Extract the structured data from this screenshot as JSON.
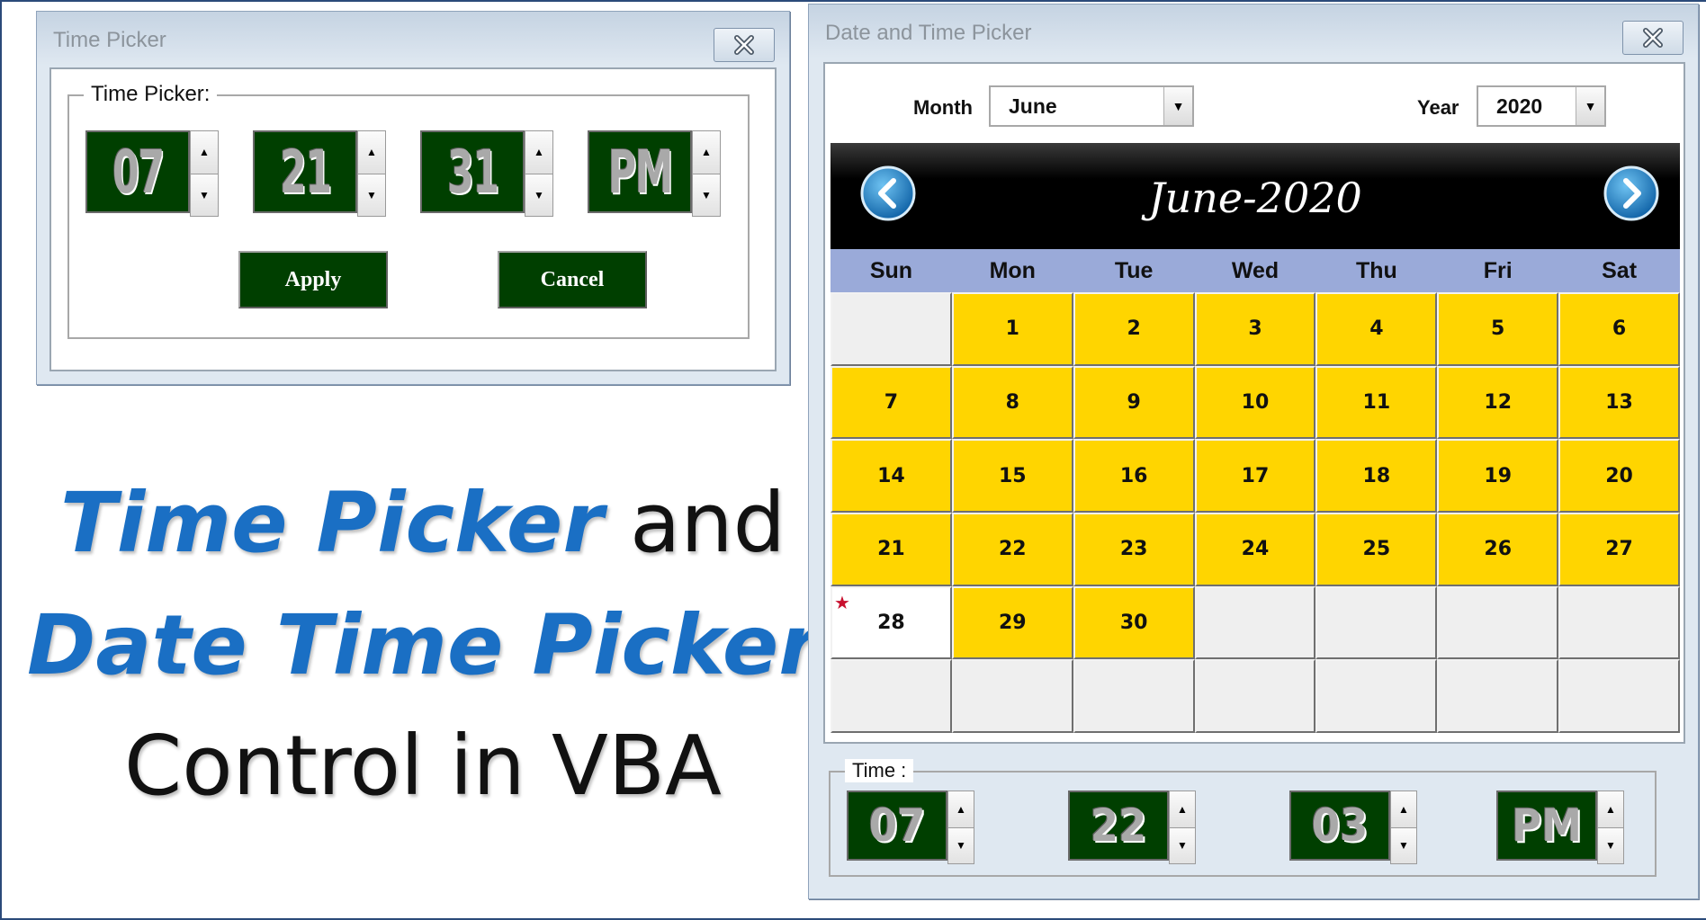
{
  "time_picker": {
    "window_title": "Time Picker",
    "group_label": "Time Picker:",
    "hour": "07",
    "minute": "21",
    "second": "31",
    "ampm": "PM",
    "apply_label": "Apply",
    "cancel_label": "Cancel"
  },
  "headline": {
    "line1_emphasis": "Time Picker",
    "line1_rest": " and",
    "line2_emphasis": "Date Time Picker",
    "line3": "Control in VBA"
  },
  "date_time_picker": {
    "window_title": "Date and Time Picker",
    "month_label": "Month",
    "month_value": "June",
    "year_label": "Year",
    "year_value": "2020",
    "calendar_title": "June-2020",
    "weekdays": [
      "Sun",
      "Mon",
      "Tue",
      "Wed",
      "Thu",
      "Fri",
      "Sat"
    ],
    "weeks": [
      [
        "",
        "1",
        "2",
        "3",
        "4",
        "5",
        "6"
      ],
      [
        "7",
        "8",
        "9",
        "10",
        "11",
        "12",
        "13"
      ],
      [
        "14",
        "15",
        "16",
        "17",
        "18",
        "19",
        "20"
      ],
      [
        "21",
        "22",
        "23",
        "24",
        "25",
        "26",
        "27"
      ],
      [
        "28",
        "29",
        "30",
        "",
        "",
        "",
        ""
      ],
      [
        "",
        "",
        "",
        "",
        "",
        "",
        ""
      ]
    ],
    "today": "28",
    "today_marker_icon": "star-icon",
    "time_label": "Time :",
    "hour": "07",
    "minute": "22",
    "second": "03",
    "ampm": "PM"
  },
  "colors": {
    "digit_background": "#003f00",
    "day_highlight": "#ffd500",
    "weekday_header": "#9aaad9",
    "headline_blue": "#1a6fc4",
    "today_marker": "#c8102e"
  }
}
